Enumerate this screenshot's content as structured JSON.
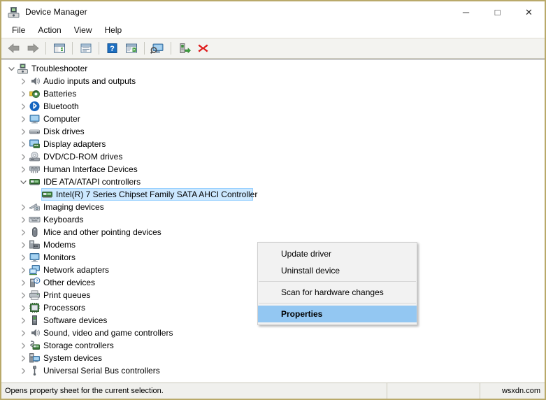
{
  "window": {
    "title": "Device Manager",
    "app_icon": "device-manager-icon",
    "controls": {
      "minimize": "─",
      "maximize": "□",
      "close": "✕"
    }
  },
  "menubar": {
    "items": [
      {
        "label": "File"
      },
      {
        "label": "Action"
      },
      {
        "label": "View"
      },
      {
        "label": "Help"
      }
    ]
  },
  "toolbar": {
    "buttons": [
      {
        "name": "back-button",
        "icon": "back-arrow-icon"
      },
      {
        "name": "forward-button",
        "icon": "forward-arrow-icon"
      },
      {
        "name": "separator-1",
        "icon": "separator"
      },
      {
        "name": "show-hide-console-tree-button",
        "icon": "console-tree-icon"
      },
      {
        "name": "separator-2",
        "icon": "separator"
      },
      {
        "name": "properties-button",
        "icon": "properties-window-icon"
      },
      {
        "name": "separator-3",
        "icon": "separator"
      },
      {
        "name": "help-button",
        "icon": "help-question-icon"
      },
      {
        "name": "action-button",
        "icon": "action-play-icon"
      },
      {
        "name": "separator-4",
        "icon": "separator"
      },
      {
        "name": "scan-for-hardware-changes-button",
        "icon": "scan-monitor-icon"
      },
      {
        "name": "separator-5",
        "icon": "separator"
      },
      {
        "name": "update-driver-button",
        "icon": "update-driver-icon"
      },
      {
        "name": "uninstall-device-button",
        "icon": "red-x-icon"
      }
    ]
  },
  "tree": {
    "root": {
      "label": "Troubleshooter",
      "icon": "computer-root-icon",
      "expanded": true
    },
    "nodes": [
      {
        "label": "Audio inputs and outputs",
        "icon": "speaker-icon",
        "expanded": false,
        "level": 1
      },
      {
        "label": "Batteries",
        "icon": "battery-icon",
        "expanded": false,
        "level": 1
      },
      {
        "label": "Bluetooth",
        "icon": "bluetooth-icon",
        "expanded": false,
        "level": 1
      },
      {
        "label": "Computer",
        "icon": "monitor-icon",
        "expanded": false,
        "level": 1
      },
      {
        "label": "Disk drives",
        "icon": "disk-drive-icon",
        "expanded": false,
        "level": 1
      },
      {
        "label": "Display adapters",
        "icon": "display-adapter-icon",
        "expanded": false,
        "level": 1
      },
      {
        "label": "DVD/CD-ROM drives",
        "icon": "optical-drive-icon",
        "expanded": false,
        "level": 1
      },
      {
        "label": "Human Interface Devices",
        "icon": "hid-icon",
        "expanded": false,
        "level": 1
      },
      {
        "label": "IDE ATA/ATAPI controllers",
        "icon": "ide-controller-icon",
        "expanded": true,
        "level": 1
      },
      {
        "label": "Intel(R) 7 Series Chipset Family SATA AHCI Controller",
        "icon": "sata-controller-icon",
        "expanded": null,
        "level": 2,
        "selected": true
      },
      {
        "label": "Imaging devices",
        "icon": "imaging-device-icon",
        "expanded": false,
        "level": 1
      },
      {
        "label": "Keyboards",
        "icon": "keyboard-icon",
        "expanded": false,
        "level": 1
      },
      {
        "label": "Mice and other pointing devices",
        "icon": "mouse-icon",
        "expanded": false,
        "level": 1
      },
      {
        "label": "Modems",
        "icon": "modem-icon",
        "expanded": false,
        "level": 1
      },
      {
        "label": "Monitors",
        "icon": "monitor-icon",
        "expanded": false,
        "level": 1
      },
      {
        "label": "Network adapters",
        "icon": "network-adapter-icon",
        "expanded": false,
        "level": 1
      },
      {
        "label": "Other devices",
        "icon": "other-device-icon",
        "expanded": false,
        "level": 1
      },
      {
        "label": "Print queues",
        "icon": "printer-icon",
        "expanded": false,
        "level": 1
      },
      {
        "label": "Processors",
        "icon": "processor-icon",
        "expanded": false,
        "level": 1
      },
      {
        "label": "Software devices",
        "icon": "software-device-icon",
        "expanded": false,
        "level": 1
      },
      {
        "label": "Sound, video and game controllers",
        "icon": "speaker-icon",
        "expanded": false,
        "level": 1
      },
      {
        "label": "Storage controllers",
        "icon": "storage-controller-icon",
        "expanded": false,
        "level": 1
      },
      {
        "label": "System devices",
        "icon": "system-device-icon",
        "expanded": false,
        "level": 1
      },
      {
        "label": "Universal Serial Bus controllers",
        "icon": "usb-icon",
        "expanded": false,
        "level": 1
      }
    ]
  },
  "context_menu": {
    "items": [
      {
        "label": "Update driver",
        "highlighted": false,
        "separator_after": false
      },
      {
        "label": "Uninstall device",
        "highlighted": false,
        "separator_after": true
      },
      {
        "label": "Scan for hardware changes",
        "highlighted": false,
        "separator_after": true
      },
      {
        "label": "Properties",
        "highlighted": true,
        "separator_after": false
      }
    ]
  },
  "statusbar": {
    "message": "Opens property sheet for the current selection.",
    "middle": "",
    "right": "wsxdn.com"
  },
  "colors": {
    "window_border": "#b9a96a",
    "selection_blue": "#cce8ff",
    "menu_highlight": "#93c7f2",
    "toolbar_bg": "#f3f3f0",
    "statusbar_bg": "#f0f0ed"
  }
}
